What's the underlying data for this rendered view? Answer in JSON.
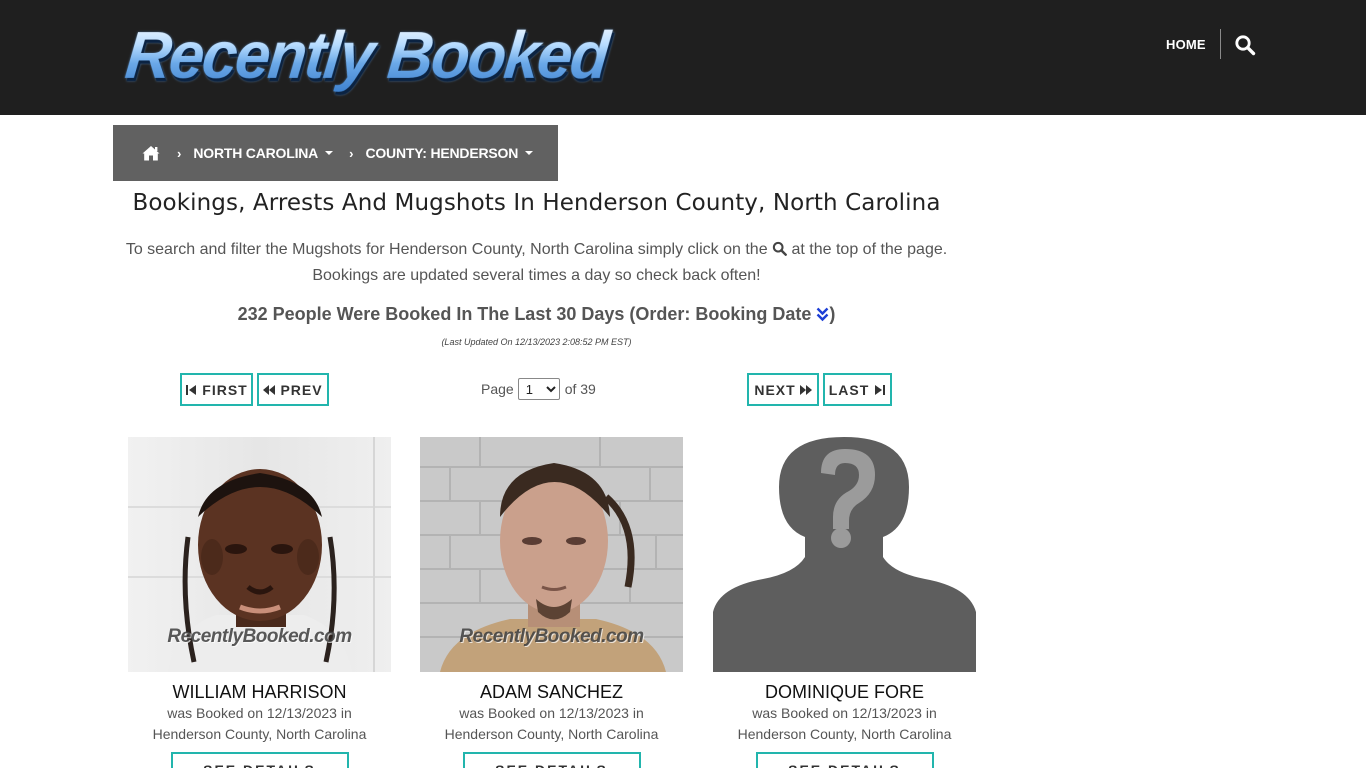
{
  "header": {
    "logo_text": "Recently Booked",
    "nav_home": "HOME",
    "search_icon": "search-icon"
  },
  "breadcrumb": {
    "home_icon": "home-icon",
    "items": [
      {
        "label": "NORTH CAROLINA"
      },
      {
        "label": "COUNTY: HENDERSON"
      }
    ]
  },
  "main": {
    "title": "Bookings, Arrests And Mugshots In Henderson County, North Carolina",
    "intro_part1": "To search and filter the Mugshots for Henderson County, North Carolina simply click on the",
    "intro_part2": "at the top of the page. Bookings are updated several times a day so check back often!",
    "count_line": "232 People Were Booked In The Last 30 Days (Order: Booking Date",
    "count_close": ")",
    "last_updated": "(Last Updated On 12/13/2023 2:08:52 PM EST)"
  },
  "pager": {
    "first": "FIRST",
    "prev": "PREV",
    "next": "NEXT",
    "last": "LAST",
    "page_label": "Page",
    "current_page": "1",
    "of_label": "of 39",
    "options": [
      "1"
    ]
  },
  "records": [
    {
      "name": "WILLIAM HARRISON",
      "booked": "was Booked on 12/13/2023 in",
      "location": "Henderson County, North Carolina",
      "watermark": "RecentlyBooked.com",
      "button": "SEE DETAILS"
    },
    {
      "name": "ADAM SANCHEZ",
      "booked": "was Booked on 12/13/2023 in",
      "location": "Henderson County, North Carolina",
      "watermark": "RecentlyBooked.com",
      "button": "SEE DETAILS"
    },
    {
      "name": "DOMINIQUE FORE",
      "booked": "was Booked on 12/13/2023 in",
      "location": "Henderson County, North Carolina",
      "watermark": "",
      "button": "SEE DETAILS"
    }
  ],
  "colors": {
    "header_bg": "#1f1f1f",
    "breadcrumb_bg": "#616161",
    "accent_teal": "#22b5ad",
    "sort_icon_blue": "#1d3fd6"
  }
}
